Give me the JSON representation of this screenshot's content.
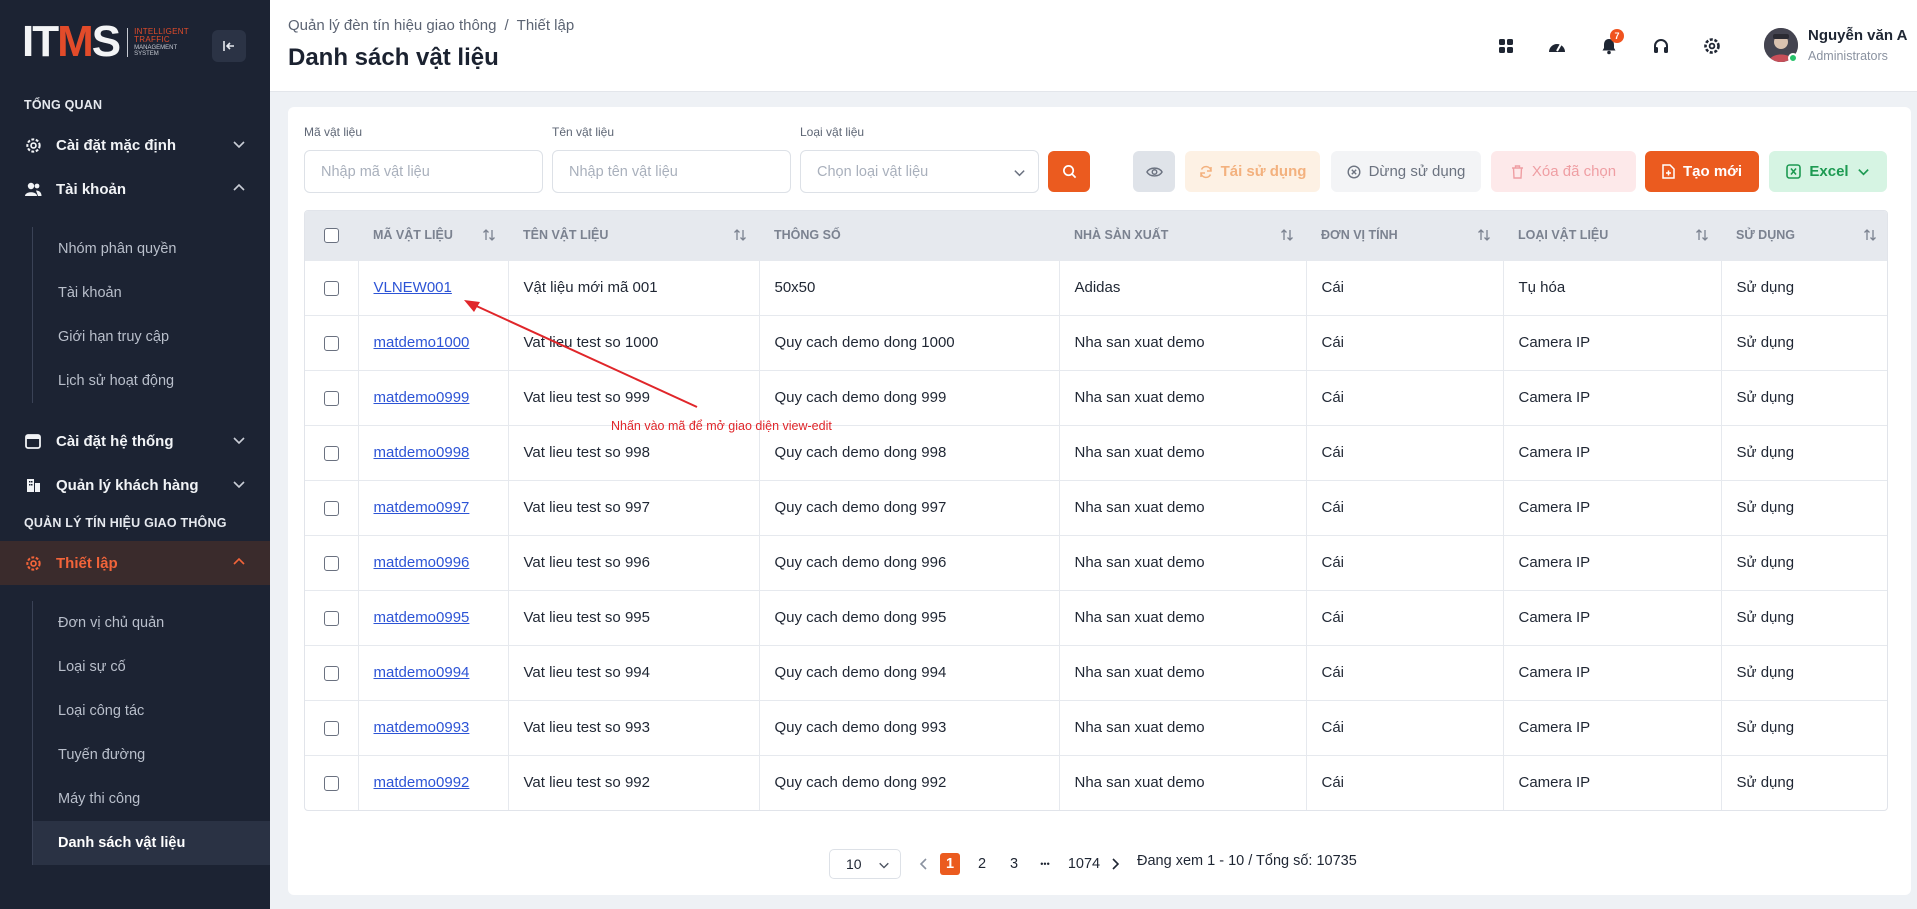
{
  "logo": {
    "main_left": "IT",
    "main_m": "M",
    "main_right": "S",
    "sub1": "INTELLIGENT",
    "sub2": "TRAFFIC",
    "sub3": "MANAGEMENT",
    "sub4": "SYSTEM"
  },
  "sidebar": {
    "section_overview": "TỔNG QUAN",
    "default_settings": "Cài đặt mặc định",
    "account": "Tài khoản",
    "account_sub": [
      "Nhóm phân quyền",
      "Tài khoản",
      "Giới hạn truy cập",
      "Lịch sử hoạt động"
    ],
    "system_settings": "Cài đặt hệ thống",
    "customer_mgmt": "Quản lý khách hàng",
    "section_signal": "QUẢN LÝ TÍN HIỆU GIAO THÔNG",
    "setup": "Thiết lập",
    "setup_sub": [
      "Đơn vị chủ quản",
      "Loại sự cố",
      "Loại công tác",
      "Tuyến đường",
      "Máy thi công",
      "Danh sách vật liệu"
    ]
  },
  "header": {
    "breadcrumb_root": "Quản lý đèn tín hiệu giao thông",
    "breadcrumb_sep": "/",
    "breadcrumb_current": "Thiết lập",
    "title": "Danh sách vật liệu",
    "notification_count": "7",
    "user_name": "Nguyễn văn A",
    "user_role": "Administrators"
  },
  "filters": {
    "code_label": "Mã vật liệu",
    "code_placeholder": "Nhập mã vật liệu",
    "name_label": "Tên vật liệu",
    "name_placeholder": "Nhập tên vật liệu",
    "type_label": "Loại vật liệu",
    "type_placeholder": "Chọn loại vật liệu"
  },
  "toolbar": {
    "reuse": "Tái sử dụng",
    "stop": "Dừng sử dụng",
    "delete": "Xóa đã chọn",
    "create": "Tạo mới",
    "excel": "Excel"
  },
  "table": {
    "headers": [
      "MÃ VẬT LIỆU",
      "TÊN VẬT LIỆU",
      "THÔNG SỐ",
      "NHÀ SẢN XUẤT",
      "ĐƠN VỊ TÍNH",
      "LOẠI VẬT LIỆU",
      "SỬ DỤNG"
    ],
    "rows": [
      [
        "VLNEW001",
        "Vật liệu mới mã 001",
        "50x50",
        "Adidas",
        "Cái",
        "Tụ hóa",
        "Sử dụng"
      ],
      [
        "matdemo1000",
        "Vat lieu test so 1000",
        "Quy cach demo dong 1000",
        "Nha san xuat demo",
        "Cái",
        "Camera IP",
        "Sử dụng"
      ],
      [
        "matdemo0999",
        "Vat lieu test so 999",
        "Quy cach demo dong 999",
        "Nha san xuat demo",
        "Cái",
        "Camera IP",
        "Sử dụng"
      ],
      [
        "matdemo0998",
        "Vat lieu test so 998",
        "Quy cach demo dong 998",
        "Nha san xuat demo",
        "Cái",
        "Camera IP",
        "Sử dụng"
      ],
      [
        "matdemo0997",
        "Vat lieu test so 997",
        "Quy cach demo dong 997",
        "Nha san xuat demo",
        "Cái",
        "Camera IP",
        "Sử dụng"
      ],
      [
        "matdemo0996",
        "Vat lieu test so 996",
        "Quy cach demo dong 996",
        "Nha san xuat demo",
        "Cái",
        "Camera IP",
        "Sử dụng"
      ],
      [
        "matdemo0995",
        "Vat lieu test so 995",
        "Quy cach demo dong 995",
        "Nha san xuat demo",
        "Cái",
        "Camera IP",
        "Sử dụng"
      ],
      [
        "matdemo0994",
        "Vat lieu test so 994",
        "Quy cach demo dong 994",
        "Nha san xuat demo",
        "Cái",
        "Camera IP",
        "Sử dụng"
      ],
      [
        "matdemo0993",
        "Vat lieu test so 993",
        "Quy cach demo dong 993",
        "Nha san xuat demo",
        "Cái",
        "Camera IP",
        "Sử dụng"
      ],
      [
        "matdemo0992",
        "Vat lieu test so 992",
        "Quy cach demo dong 992",
        "Nha san xuat demo",
        "Cái",
        "Camera IP",
        "Sử dụng"
      ]
    ]
  },
  "annotation": "Nhấn vào mã để mở giao diện view-edit",
  "pagination": {
    "page_size": "10",
    "pages": [
      "1",
      "2",
      "3"
    ],
    "ellipsis": "•••",
    "last_page": "1074",
    "info": "Đang xem 1 - 10 / Tổng số: 10735"
  },
  "colors": {
    "accent": "#eb5b1f",
    "sidebar_bg": "#1c2333",
    "link": "#2d54d6",
    "annotation": "#e0262a"
  },
  "icons": [
    "collapse-icon",
    "gear-icon",
    "user-icon",
    "chevron-down-icon",
    "chevron-up-icon",
    "building-icon",
    "grid-icon",
    "dashboard-icon",
    "bell-icon",
    "headset-icon",
    "search-icon",
    "eye-icon",
    "refresh-icon",
    "x-circle-icon",
    "trash-icon",
    "file-plus-icon",
    "excel-icon",
    "sort-icon",
    "arrow-left-icon",
    "arrow-right-icon"
  ]
}
